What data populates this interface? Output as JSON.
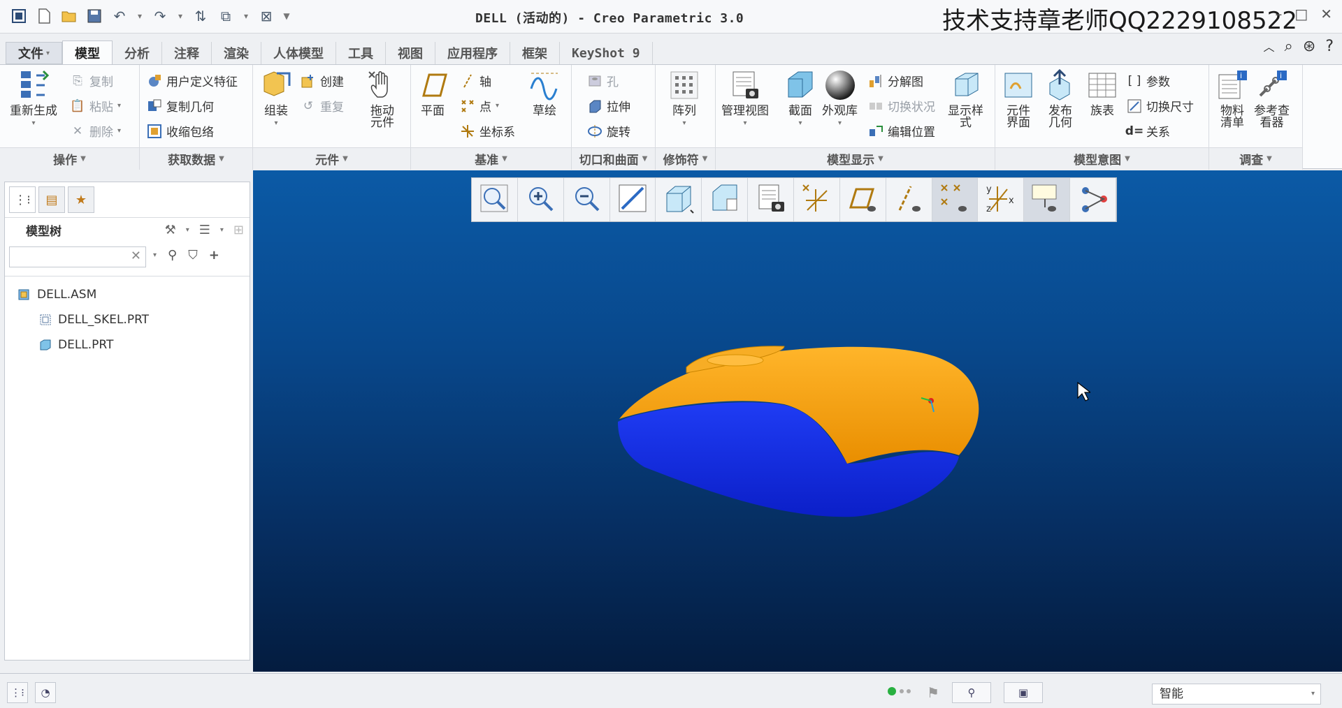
{
  "window": {
    "title": "DELL (活动的) - Creo Parametric 3.0",
    "watermark": "技术支持章老师QQ2229108522"
  },
  "quick_access": [
    "new-icon",
    "open-icon",
    "save-icon",
    "undo-icon",
    "redo-icon",
    "regenerate-icon",
    "windows-icon",
    "close-icon",
    "customize-icon"
  ],
  "tabs": [
    {
      "label": "文件",
      "id": "file"
    },
    {
      "label": "模型",
      "id": "model"
    },
    {
      "label": "分析",
      "id": "analysis"
    },
    {
      "label": "注释",
      "id": "annotate"
    },
    {
      "label": "渲染",
      "id": "render"
    },
    {
      "label": "人体模型",
      "id": "manikin"
    },
    {
      "label": "工具",
      "id": "tools"
    },
    {
      "label": "视图",
      "id": "view"
    },
    {
      "label": "应用程序",
      "id": "applications"
    },
    {
      "label": "框架",
      "id": "framework"
    },
    {
      "label": "KeyShot 9",
      "id": "keyshot"
    }
  ],
  "ribbon": {
    "operations": {
      "label": "操作",
      "regenerate": "重新生成",
      "copy": "复制",
      "paste": "粘贴",
      "delete": "删除"
    },
    "get_data": {
      "label": "获取数据",
      "udf": "用户定义特征",
      "copy_geom": "复制几何",
      "shrinkwrap": "收缩包络"
    },
    "component": {
      "label": "元件",
      "assemble": "组装",
      "create": "创建",
      "repeat": "重复",
      "drag": "拖动\n元件"
    },
    "datum": {
      "label": "基准",
      "plane": "平面",
      "axis": "轴",
      "point": "点",
      "csys": "坐标系",
      "sketch": "草绘"
    },
    "cut_surface": {
      "label": "切口和曲面",
      "hole": "孔",
      "extrude": "拉伸",
      "revolve": "旋转"
    },
    "modifiers": {
      "label": "修饰符",
      "pattern": "阵列"
    },
    "model_display": {
      "label": "模型显示",
      "manage_views": "管理视图",
      "section": "截面",
      "appearance": "外观库",
      "exploded": "分解图",
      "toggle_status": "切换状况",
      "edit_position": "编辑位置",
      "display_style": "显示样\n式"
    },
    "model_intent": {
      "label": "模型意图",
      "comp_interface": "元件\n界面",
      "publish_geom": "发布\n几何",
      "family_table": "族表",
      "parameters": "参数",
      "switch_dims": "切换尺寸",
      "relations": "关系"
    },
    "investigate": {
      "label": "调查",
      "bom": "物料\n清单",
      "ref_viewer": "参考查\n看器"
    }
  },
  "model_tree": {
    "title": "模型树",
    "search_value": "",
    "nodes": [
      {
        "label": "DELL.ASM",
        "type": "assembly"
      },
      {
        "label": "DELL_SKEL.PRT",
        "type": "skeleton"
      },
      {
        "label": "DELL.PRT",
        "type": "part"
      }
    ]
  },
  "view_toolbar": [
    "refit-icon",
    "zoom-in-icon",
    "zoom-out-icon",
    "repaint-icon",
    "display-style-icon",
    "saved-views-icon",
    "view-manager-icon",
    "datum-display-icon",
    "plane-display-icon",
    "axis-display-icon",
    "point-display-icon",
    "csys-display-icon",
    "annotation-display-icon",
    "spin-center-icon"
  ],
  "status_bar": {
    "filter_value": "智能"
  },
  "colors": {
    "model_top": "#f0a000",
    "model_bottom": "#1430e6",
    "viewport_top": "#0b5aa6",
    "viewport_bottom": "#041c3f"
  }
}
